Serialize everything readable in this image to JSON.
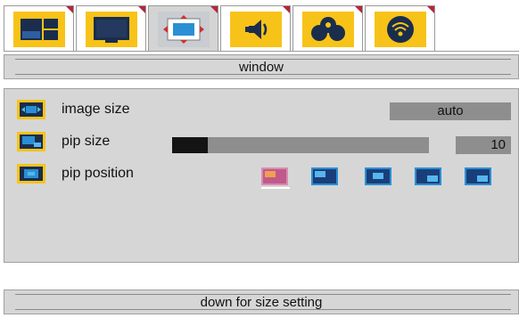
{
  "tabs": [
    {
      "icon": "picture-icon",
      "selected": false
    },
    {
      "icon": "monitor-icon",
      "selected": false
    },
    {
      "icon": "window-icon",
      "selected": true
    },
    {
      "icon": "speaker-icon",
      "selected": false
    },
    {
      "icon": "options-icon",
      "selected": false
    },
    {
      "icon": "signal-icon",
      "selected": false
    }
  ],
  "header": {
    "title": "window"
  },
  "settings": {
    "image_size": {
      "label": "image size",
      "value": "auto",
      "icon": "image-size-icon"
    },
    "pip_size": {
      "label": "pip size",
      "value": "10",
      "icon": "pip-size-icon",
      "level_fraction": 0.14
    },
    "pip_position": {
      "label": "pip position",
      "icon": "pip-position-icon",
      "selected_index": 0,
      "options": [
        "top-left",
        "top-left",
        "center",
        "bottom-right",
        "bottom-right"
      ]
    }
  },
  "footer": {
    "hint": "down for size setting"
  },
  "colors": {
    "accent": "#f7c319",
    "panel": "#d6d6d6",
    "value_box": "#8e8e8e",
    "marker": "#b0283a"
  }
}
